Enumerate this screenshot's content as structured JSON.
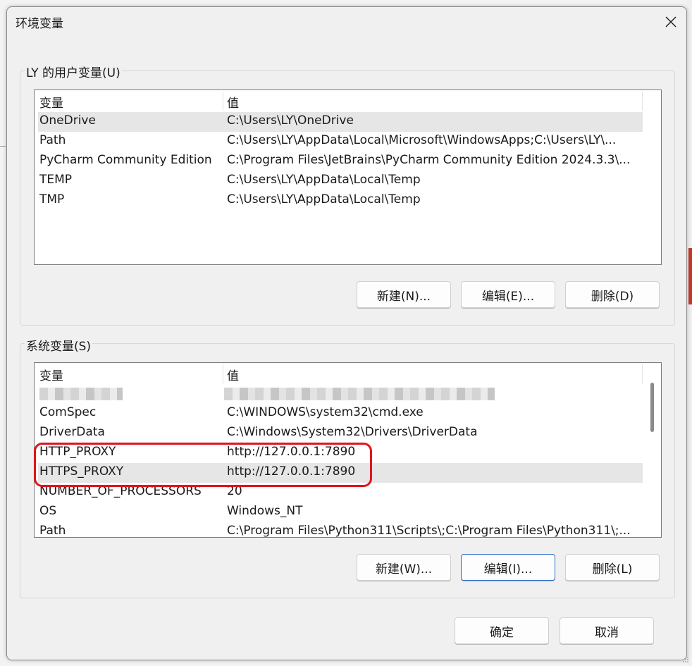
{
  "window": {
    "title": "环境变量"
  },
  "user_group": {
    "label": "LY 的用户变量(U)",
    "columns": [
      "变量",
      "值"
    ],
    "rows": [
      {
        "name": "OneDrive",
        "value": "C:\\Users\\LY\\OneDrive"
      },
      {
        "name": "Path",
        "value": "C:\\Users\\LY\\AppData\\Local\\Microsoft\\WindowsApps;C:\\Users\\LY\\..."
      },
      {
        "name": "PyCharm Community Edition",
        "value": "C:\\Program Files\\JetBrains\\PyCharm Community Edition 2024.3.3\\..."
      },
      {
        "name": "TEMP",
        "value": "C:\\Users\\LY\\AppData\\Local\\Temp"
      },
      {
        "name": "TMP",
        "value": "C:\\Users\\LY\\AppData\\Local\\Temp"
      }
    ],
    "selected_row": 0,
    "buttons": {
      "new": "新建(N)...",
      "edit": "编辑(E)...",
      "delete": "删除(D)"
    }
  },
  "system_group": {
    "label": "系统变量(S)",
    "columns": [
      "变量",
      "值"
    ],
    "rows": [
      {
        "name": "ComSpec",
        "value": "C:\\WINDOWS\\system32\\cmd.exe"
      },
      {
        "name": "DriverData",
        "value": "C:\\Windows\\System32\\Drivers\\DriverData"
      },
      {
        "name": "HTTP_PROXY",
        "value": "http://127.0.0.1:7890"
      },
      {
        "name": "HTTPS_PROXY",
        "value": "http://127.0.0.1:7890"
      },
      {
        "name": "NUMBER_OF_PROCESSORS",
        "value": "20"
      },
      {
        "name": "OS",
        "value": "Windows_NT"
      },
      {
        "name": "Path",
        "value": "C:\\Program Files\\Python311\\Scripts\\;C:\\Program Files\\Python311\\;..."
      }
    ],
    "selected_row": 3,
    "buttons": {
      "new": "新建(W)...",
      "edit": "编辑(I)...",
      "delete": "删除(L)"
    }
  },
  "footer": {
    "ok": "确定",
    "cancel": "取消"
  },
  "colors": {
    "highlight": "#e0141e",
    "focus": "#2e6fc8",
    "selection": "#e6e6e6"
  },
  "icons": {
    "close": "close-icon"
  }
}
